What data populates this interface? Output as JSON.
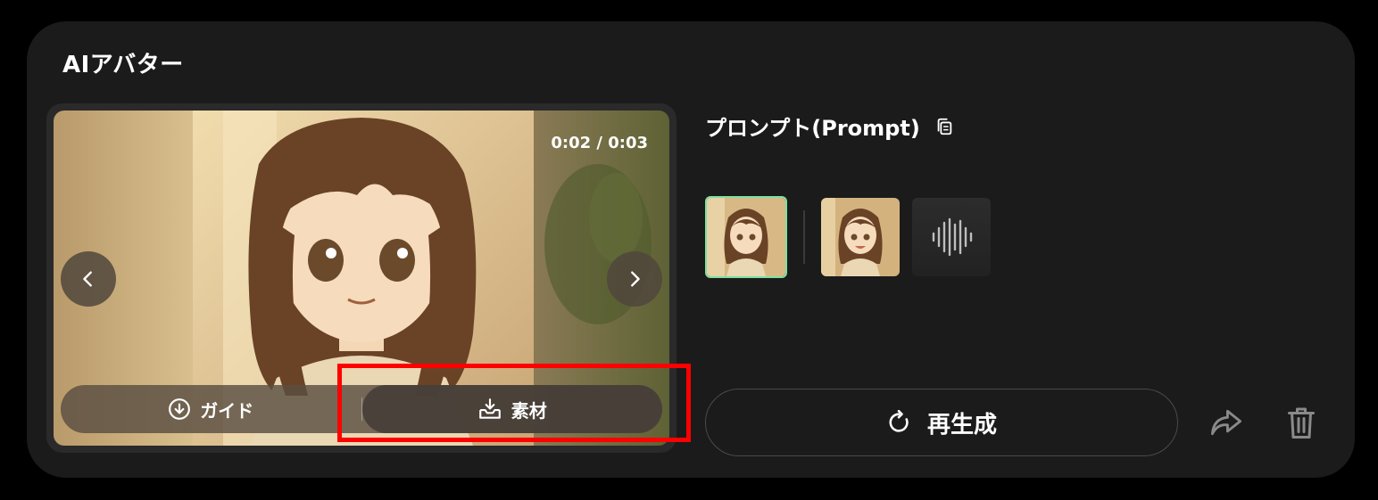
{
  "card": {
    "title": "AIアバター"
  },
  "player": {
    "timecode": "0:02 / 0:03",
    "actions": {
      "guide_label": "ガイド",
      "material_label": "素材"
    }
  },
  "prompt": {
    "title": "プロンプト(Prompt)"
  },
  "regenerate": {
    "label": "再生成"
  },
  "colors": {
    "card_bg": "#1b1b1b",
    "active_thumb_border": "#7ee0a0",
    "highlight": "#ff0000"
  },
  "icons": [
    "chevron-left-icon",
    "chevron-right-icon",
    "download-circle-icon",
    "inbox-download-icon",
    "copy-icon",
    "refresh-icon",
    "share-icon",
    "trash-icon",
    "waveform-icon"
  ]
}
